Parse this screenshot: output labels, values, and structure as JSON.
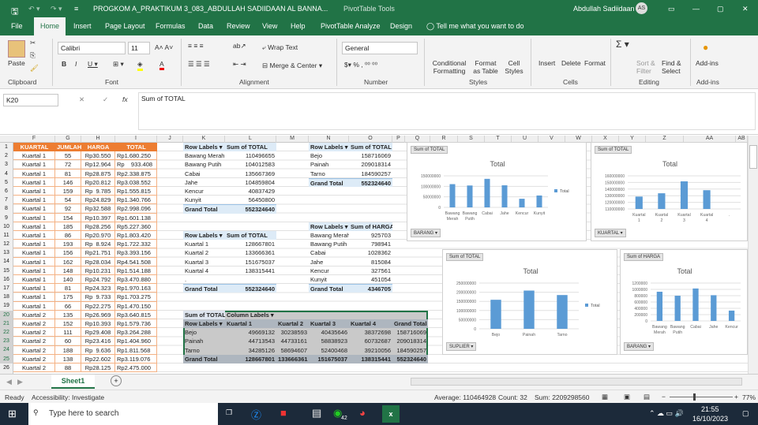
{
  "title": {
    "doc": "PROGKOM A_PRAKTIKUM 3_083_ABDULLAH SADIIDAAN AL BANNA...",
    "context": "PivotTable Tools",
    "user": "Abdullah Sadiidaan",
    "initials": "AS"
  },
  "tabs": [
    "File",
    "Home",
    "Insert",
    "Page Layout",
    "Formulas",
    "Data",
    "Review",
    "View",
    "Help",
    "PivotTable Analyze",
    "Design"
  ],
  "tell_me": "Tell me what you want to do",
  "ribbon": {
    "paste": "Paste",
    "font_name": "Calibri",
    "font_size": "11",
    "wrap": "Wrap Text",
    "merge": "Merge & Center",
    "number_format": "General",
    "cond": "Conditional Formatting",
    "format_table": "Format as Table",
    "cell_styles": "Cell Styles",
    "insert": "Insert",
    "delete": "Delete",
    "format": "Format",
    "sort": "Sort & Filter",
    "find": "Find & Select",
    "addins": "Add-ins",
    "groups": [
      "Clipboard",
      "Font",
      "Alignment",
      "Number",
      "Styles",
      "Cells",
      "Editing",
      "Add-ins"
    ]
  },
  "formula": {
    "namebox": "K20",
    "fx": "fx",
    "content": "Sum of TOTAL"
  },
  "columns": [
    "F",
    "G",
    "H",
    "I",
    "J",
    "K",
    "L",
    "M",
    "N",
    "O",
    "P",
    "Q",
    "R",
    "S",
    "T",
    "U",
    "V",
    "W",
    "X",
    "Y",
    "Z",
    "AA",
    "AB"
  ],
  "data_table": {
    "headers": [
      "KUARTAL",
      "JUMLAH",
      "HARGA",
      "TOTAL"
    ],
    "rows": [
      [
        "Kuartal 1",
        "55",
        "Rp30.550",
        "Rp1.680.250"
      ],
      [
        "Kuartal 1",
        "72",
        "Rp12.964",
        "Rp    933.408"
      ],
      [
        "Kuartal 1",
        "81",
        "Rp28.875",
        "Rp2.338.875"
      ],
      [
        "Kuartal 1",
        "146",
        "Rp20.812",
        "Rp3.038.552"
      ],
      [
        "Kuartal 1",
        "159",
        "Rp  9.785",
        "Rp1.555.815"
      ],
      [
        "Kuartal 1",
        "54",
        "Rp24.829",
        "Rp1.340.766"
      ],
      [
        "Kuartal 1",
        "92",
        "Rp32.588",
        "Rp2.998.096"
      ],
      [
        "Kuartal 1",
        "154",
        "Rp10.397",
        "Rp1.601.138"
      ],
      [
        "Kuartal 1",
        "185",
        "Rp28.256",
        "Rp5.227.360"
      ],
      [
        "Kuartal 1",
        "86",
        "Rp20.970",
        "Rp1.803.420"
      ],
      [
        "Kuartal 1",
        "193",
        "Rp  8.924",
        "Rp1.722.332"
      ],
      [
        "Kuartal 1",
        "156",
        "Rp21.751",
        "Rp3.393.156"
      ],
      [
        "Kuartal 1",
        "162",
        "Rp28.034",
        "Rp4.541.508"
      ],
      [
        "Kuartal 1",
        "148",
        "Rp10.231",
        "Rp1.514.188"
      ],
      [
        "Kuartal 1",
        "140",
        "Rp24.792",
        "Rp3.470.880"
      ],
      [
        "Kuartal 1",
        "81",
        "Rp24.323",
        "Rp1.970.163"
      ],
      [
        "Kuartal 1",
        "175",
        "Rp  9.733",
        "Rp1.703.275"
      ],
      [
        "Kuartal 1",
        "66",
        "Rp22.275",
        "Rp1.470.150"
      ],
      [
        "Kuartal 2",
        "135",
        "Rp26.969",
        "Rp3.640.815"
      ],
      [
        "Kuartal 2",
        "152",
        "Rp10.393",
        "Rp1.579.736"
      ],
      [
        "Kuartal 2",
        "111",
        "Rp29.408",
        "Rp3.264.288"
      ],
      [
        "Kuartal 2",
        "60",
        "Rp23.416",
        "Rp1.404.960"
      ],
      [
        "Kuartal 2",
        "188",
        "Rp  9.636",
        "Rp1.811.568"
      ],
      [
        "Kuartal 2",
        "138",
        "Rp22.602",
        "Rp3.119.076"
      ],
      [
        "Kuartal 2",
        "88",
        "Rp28.125",
        "Rp2.475.000"
      ]
    ]
  },
  "pivots": [
    {
      "row": 1,
      "col": "K",
      "headers": [
        "Row Labels",
        "Sum of TOTAL"
      ],
      "rows": [
        [
          "Bawang Merah",
          "110496655"
        ],
        [
          "Bawang Putih",
          "104012583"
        ],
        [
          "Cabai",
          "135667369"
        ],
        [
          "Jahe",
          "104859804"
        ],
        [
          "Kencur",
          "40837429"
        ],
        [
          "Kunyit",
          "56450800"
        ]
      ],
      "total": [
        "Grand Total",
        "552324640"
      ]
    },
    {
      "row": 1,
      "col": "N",
      "headers": [
        "Row Labels",
        "Sum of TOTAL"
      ],
      "rows": [
        [
          "Bejo",
          "158716069"
        ],
        [
          "Painah",
          "209018314"
        ],
        [
          "Tarno",
          "184590257"
        ]
      ],
      "total": [
        "Grand Total",
        "552324640"
      ]
    },
    {
      "row": 11,
      "col": "K",
      "headers": [
        "Row Labels",
        "Sum of TOTAL"
      ],
      "rows": [
        [
          "Kuartal 1",
          "128667801"
        ],
        [
          "Kuartal 2",
          "133666361"
        ],
        [
          "Kuartal 3",
          "151675037"
        ],
        [
          "Kuartal 4",
          "138315441"
        ],
        [
          ".",
          ""
        ]
      ],
      "total": [
        "Grand Total",
        "552324640"
      ]
    },
    {
      "row": 10,
      "col": "N",
      "headers": [
        "Row Labels",
        "Sum of HARGA"
      ],
      "rows": [
        [
          "Bawang Merah",
          "925703"
        ],
        [
          "Bawang Putih",
          "798941"
        ],
        [
          "Cabai",
          "1028362"
        ],
        [
          "Jahe",
          "815084"
        ],
        [
          "Kencur",
          "327561"
        ],
        [
          "Kunyit",
          "451054"
        ]
      ],
      "total": [
        "Grand Total",
        "4346705"
      ]
    }
  ],
  "cross": {
    "corner": "Sum of TOTAL",
    "col_labels": "Column Labels",
    "headers": [
      "Row Labels",
      "Kuartal 1",
      "Kuartal 2",
      "Kuartal 3",
      "Kuartal 4",
      "Grand Total"
    ],
    "rows": [
      [
        "Bejo",
        "49669132",
        "30238593",
        "40435646",
        "38372698",
        "158716069"
      ],
      [
        "Painah",
        "44713543",
        "44733161",
        "58838923",
        "60732687",
        "209018314"
      ],
      [
        "Tarno",
        "34285126",
        "58694607",
        "52400468",
        "39210056",
        "184590257"
      ]
    ],
    "total": [
      "Grand Total",
      "128667801",
      "133666361",
      "151675037",
      "138315441",
      "552324640"
    ]
  },
  "chart_data": [
    {
      "type": "bar",
      "field_button": "Sum of TOTAL",
      "title": "Total",
      "axis_button": "BARANG",
      "legend": "Total",
      "categories": [
        "Bawang Merah",
        "Bawang Putih",
        "Cabai",
        "Jahe",
        "Kencur",
        "Kunyit"
      ],
      "values": [
        110496655,
        104012583,
        135667369,
        104859804,
        40837429,
        56450800
      ],
      "ylim": [
        0,
        150000000
      ],
      "ticks": [
        "0",
        "50000000",
        "100000000",
        "150000000"
      ]
    },
    {
      "type": "bar",
      "field_button": "Sum of TOTAL",
      "title": "Total",
      "axis_button": "KUARTAL",
      "categories": [
        "Kuartal 1",
        "Kuartal 2",
        "Kuartal 3",
        "Kuartal 4",
        "."
      ],
      "values": [
        128667801,
        133666361,
        151675037,
        138315441,
        0
      ],
      "ylim": [
        110000000,
        160000000
      ],
      "ticks": [
        "110000000",
        "120000000",
        "130000000",
        "140000000",
        "150000000",
        "160000000"
      ]
    },
    {
      "type": "bar",
      "field_button": "Sum of TOTAL",
      "title": "Total",
      "axis_button": "SUPLIER",
      "legend": "Total",
      "categories": [
        "Bejo",
        "Painah",
        "Tarno"
      ],
      "values": [
        158716069,
        209018314,
        184590257
      ],
      "ylim": [
        0,
        250000000
      ],
      "ticks": [
        "0",
        "50000000",
        "100000000",
        "150000000",
        "200000000",
        "250000000"
      ]
    },
    {
      "type": "bar",
      "field_button": "Sum of HARGA",
      "title": "Total",
      "axis_button": "BARANG",
      "categories": [
        "Bawang Merah",
        "Bawang Putih",
        "Cabai",
        "Jahe",
        "Kencur"
      ],
      "values": [
        925703,
        798941,
        1028362,
        815084,
        327561
      ],
      "ylim": [
        0,
        1200000
      ],
      "ticks": [
        "0",
        "200000",
        "400000",
        "600000",
        "800000",
        "1000000",
        "1200000"
      ]
    }
  ],
  "sheet": {
    "tab": "Sheet1",
    "add": "+"
  },
  "status": {
    "ready": "Ready",
    "accessibility": "Accessibility: Investigate",
    "average": "Average: 110464928",
    "count": "Count: 32",
    "sum": "Sum: 2209298560",
    "zoom": "77%"
  },
  "taskbar": {
    "search": "Type here to search",
    "time": "21:55",
    "date": "16/10/2023",
    "badge": "42"
  }
}
